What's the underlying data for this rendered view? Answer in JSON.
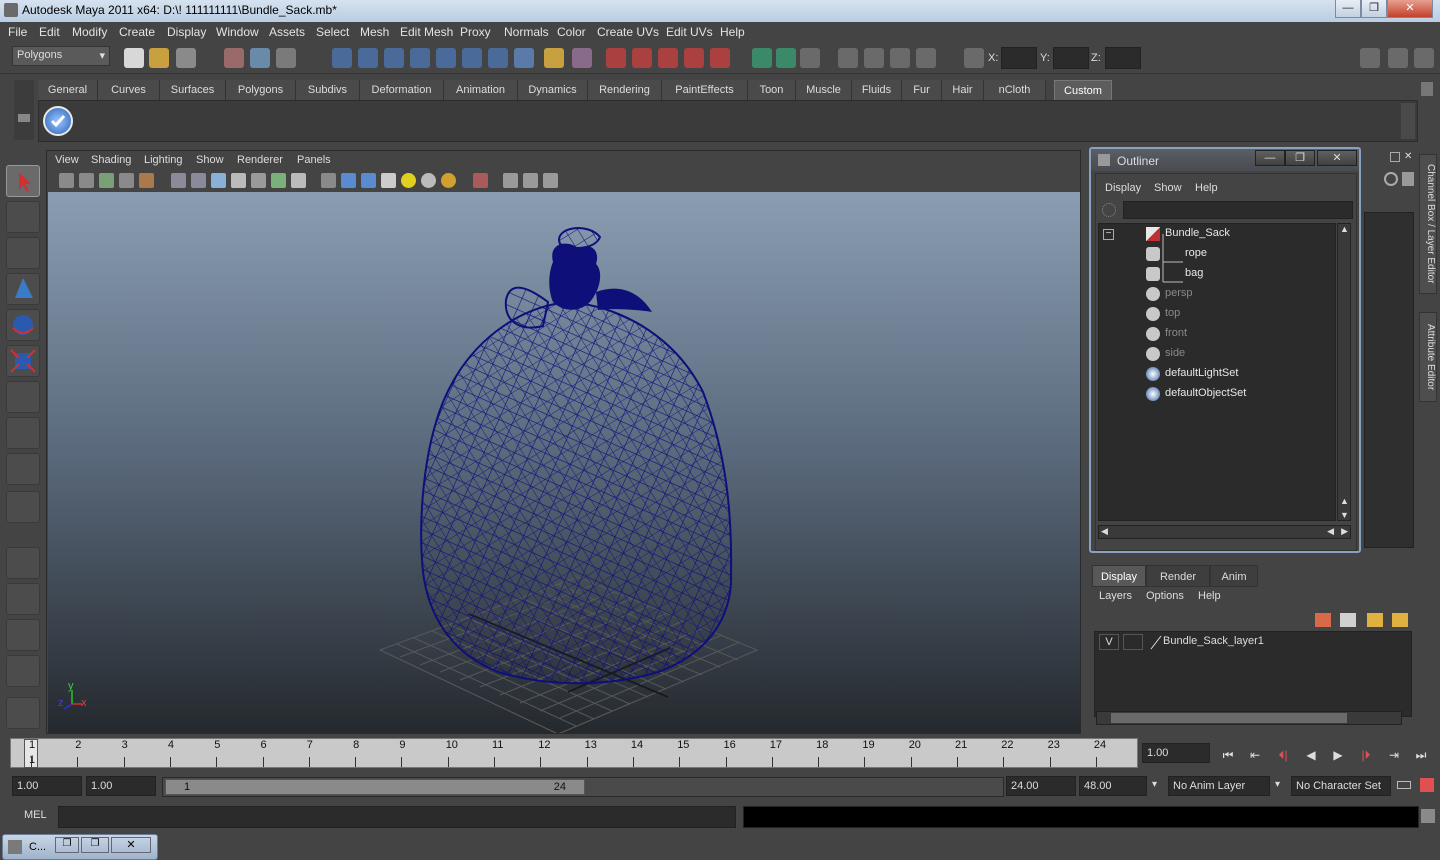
{
  "window": {
    "title": "Autodesk Maya 2011 x64: D:\\! 111111111\\Bundle_Sack.mb*",
    "minimize": "—",
    "maximize": "❐",
    "close": "✕"
  },
  "menubar": [
    "File",
    "Edit",
    "Modify",
    "Create",
    "Display",
    "Window",
    "Assets",
    "Select",
    "Mesh",
    "Edit Mesh",
    "Proxy",
    "Normals",
    "Color",
    "Create UVs",
    "Edit UVs",
    "Help"
  ],
  "statusline": {
    "mode": "Polygons",
    "coord_labels": [
      "X:",
      "Y:",
      "Z:"
    ]
  },
  "shelf": {
    "tabs": [
      "General",
      "Curves",
      "Surfaces",
      "Polygons",
      "Subdivs",
      "Deformation",
      "Animation",
      "Dynamics",
      "Rendering",
      "PaintEffects",
      "Toon",
      "Muscle",
      "Fluids",
      "Fur",
      "Hair",
      "nCloth",
      "Custom"
    ],
    "active_tab": "Custom"
  },
  "viewport": {
    "menu": [
      "View",
      "Shading",
      "Lighting",
      "Show",
      "Renderer",
      "Panels"
    ],
    "axis_y": "y",
    "axis_x": "x",
    "axis_z": "z",
    "wire_color": "#0f0f7a"
  },
  "outliner": {
    "title": "Outliner",
    "menu": [
      "Display",
      "Show",
      "Help"
    ],
    "collapse_symbol": "−",
    "items": [
      {
        "label": "Bundle_Sack",
        "dim": false
      },
      {
        "label": "rope",
        "dim": false
      },
      {
        "label": "bag",
        "dim": false
      },
      {
        "label": "persp",
        "dim": true
      },
      {
        "label": "top",
        "dim": true
      },
      {
        "label": "front",
        "dim": true
      },
      {
        "label": "side",
        "dim": true
      },
      {
        "label": "defaultLightSet",
        "dim": false
      },
      {
        "label": "defaultObjectSet",
        "dim": false
      }
    ]
  },
  "sidebar_tabs": [
    "Channel Box / Layer Editor",
    "Attribute Editor"
  ],
  "layer_editor": {
    "tabs": [
      "Display",
      "Render",
      "Anim"
    ],
    "active_tab": "Display",
    "menu": [
      "Layers",
      "Options",
      "Help"
    ],
    "layer": {
      "visibility": "V",
      "name": "Bundle_Sack_layer1"
    }
  },
  "timeline": {
    "ticks": [
      "1",
      "2",
      "3",
      "4",
      "5",
      "6",
      "7",
      "8",
      "9",
      "10",
      "11",
      "12",
      "13",
      "14",
      "15",
      "16",
      "17",
      "18",
      "19",
      "20",
      "21",
      "22",
      "23",
      "24"
    ],
    "current_frame_marker": "1",
    "current_time": "1.00",
    "controls": [
      "⏮",
      "⇤",
      "⏴|",
      "◀",
      "▶",
      "|⏵",
      "⇥",
      "⏭"
    ]
  },
  "range": {
    "start": "1.00",
    "playback_start": "1.00",
    "bar_start": "1",
    "bar_end": "24",
    "playback_end": "24.00",
    "end": "48.00",
    "anim_layer": "No Anim Layer",
    "character_set": "No Character Set"
  },
  "command_line": {
    "label": "MEL"
  },
  "minimized_window": {
    "label": "C..."
  }
}
